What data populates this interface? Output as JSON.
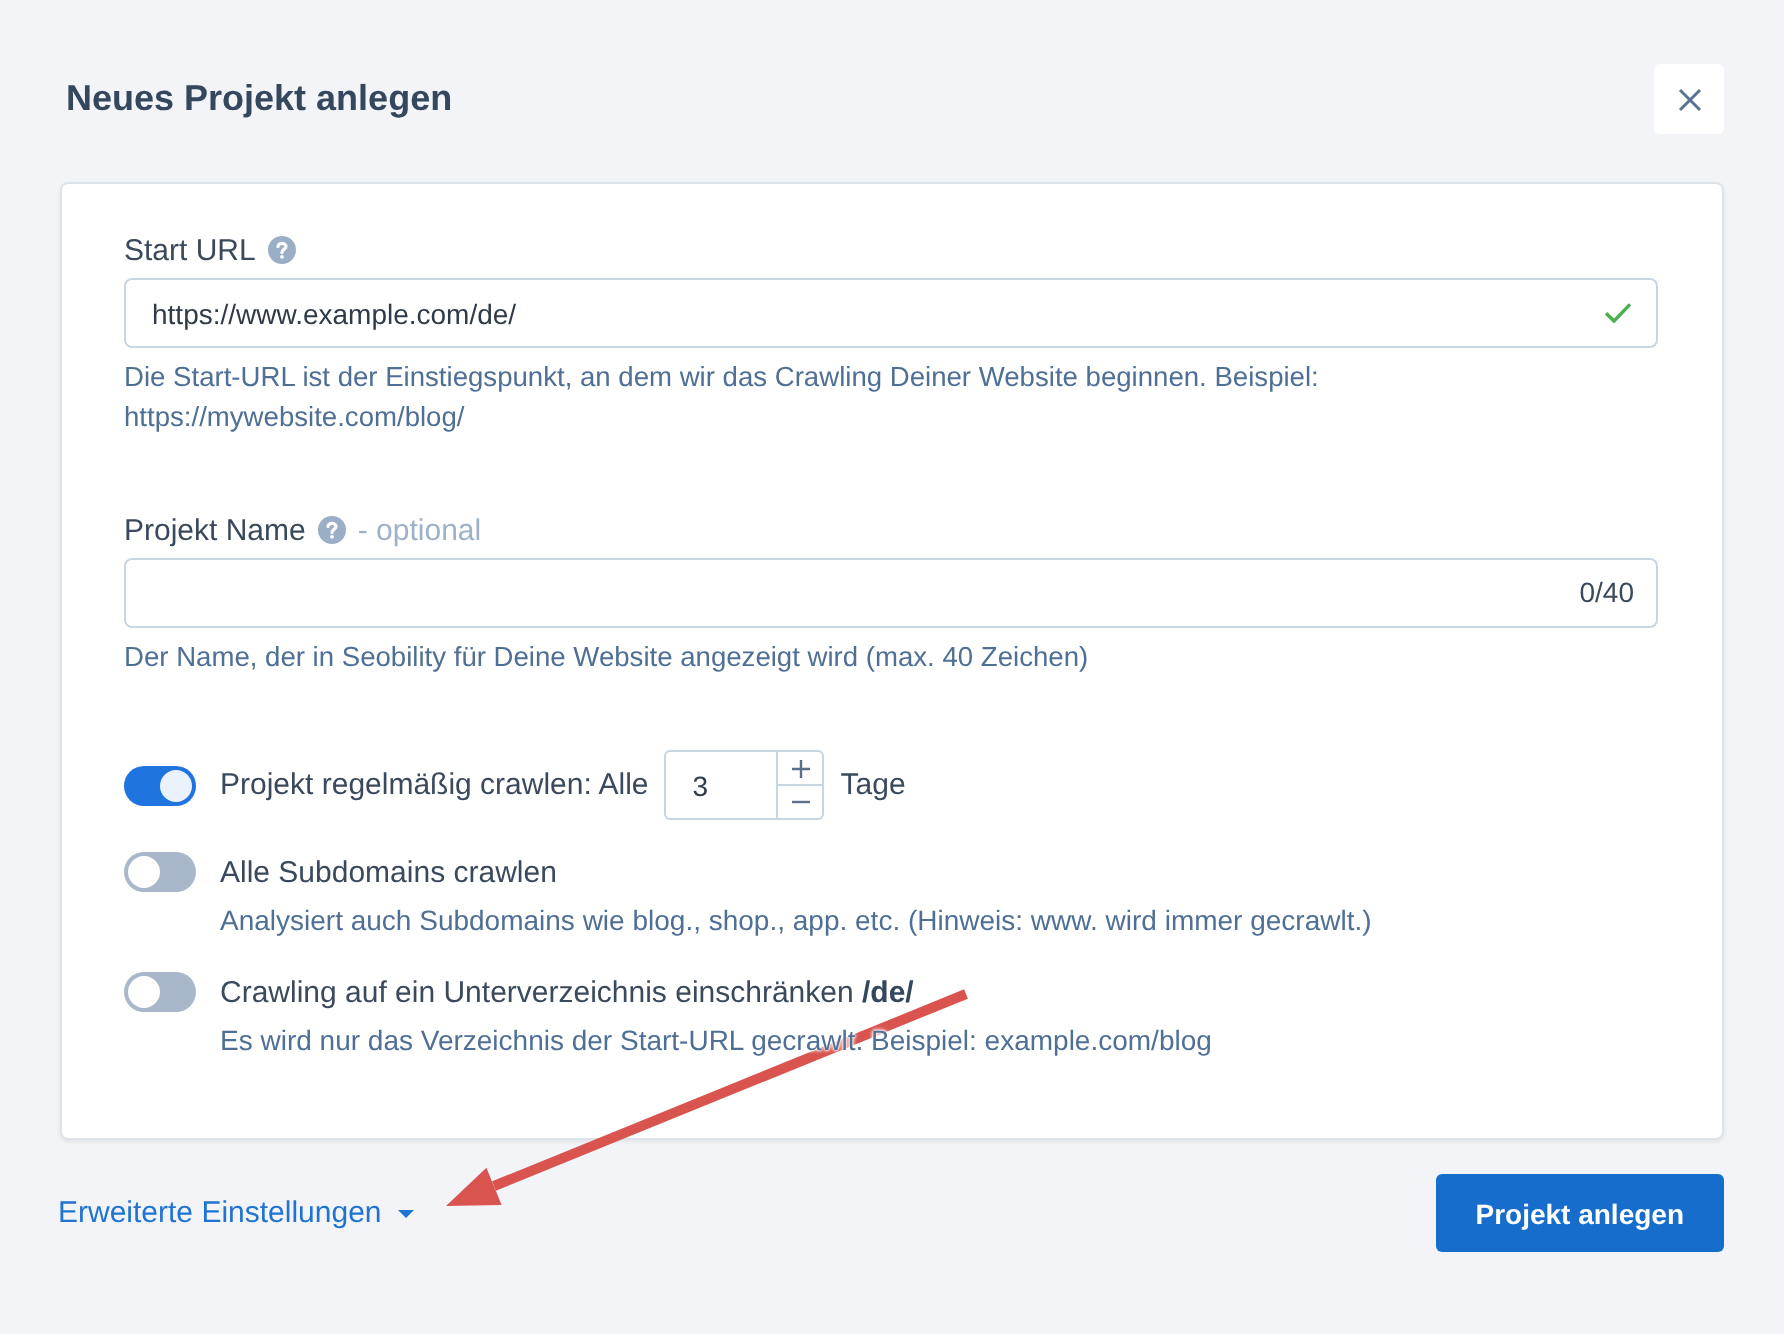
{
  "dialog": {
    "title": "Neues Projekt anlegen"
  },
  "fields": [
    {
      "label": "Start URL",
      "value": "https://www.example.com/de/",
      "valid": true,
      "hint": "Die Start-URL ist der Einstiegspunkt, an dem wir das Crawling Deiner Website beginnen. Beispiel: https://mywebsite.com/blog/"
    },
    {
      "label": "Projekt Name",
      "optional_note": "- optional",
      "counter": "0/40",
      "hint": "Der Name, der in Seobility für Deine Website angezeigt wird (max. 40 Zeichen)"
    }
  ],
  "options": [
    {
      "kind": "interval",
      "on": true,
      "label": "Projekt regelmäßig crawlen: Alle",
      "value": "3",
      "unit": "Tage"
    },
    {
      "kind": "plain",
      "on": false,
      "label": "Alle Subdomains crawlen",
      "hint": "Analysiert auch Subdomains wie blog., shop., app. etc. (Hinweis: www. wird immer gecrawlt.)"
    },
    {
      "kind": "plain",
      "on": false,
      "label": "Crawling auf ein Unterverzeichnis einschränken **/de/**",
      "hint": "Es wird nur das Verzeichnis der Start-URL gecrawlt. Beispiel: example.com/blog"
    }
  ],
  "footer": {
    "advanced_link": "Erweiterte Einstellungen",
    "submit": "Projekt anlegen"
  }
}
